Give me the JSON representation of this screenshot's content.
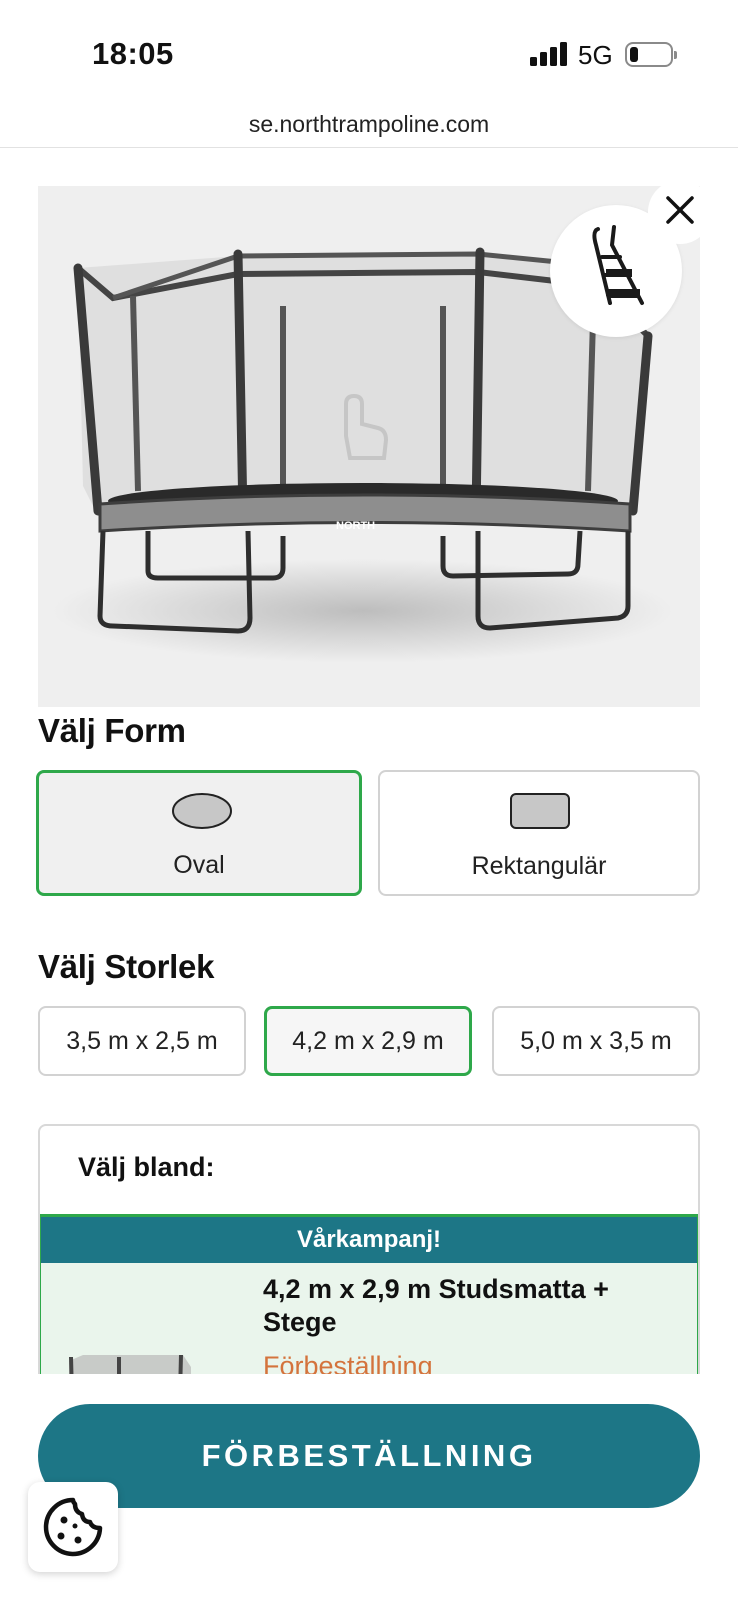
{
  "status_bar": {
    "time": "18:05",
    "network": "5G",
    "battery_level": 0.2
  },
  "browser": {
    "url": "se.northtrampoline.com"
  },
  "product_image": {
    "accessory_icon": "ladder-icon",
    "close_icon": "close-icon",
    "overlay_icon": "hand-pointer-icon"
  },
  "shape_section": {
    "title": "Välj Form",
    "options": [
      {
        "label": "Oval",
        "icon": "oval-shape-icon",
        "selected": true
      },
      {
        "label": "Rektangulär",
        "icon": "rectangle-shape-icon",
        "selected": false
      }
    ]
  },
  "size_section": {
    "title": "Välj Storlek",
    "options": [
      {
        "label": "3,5 m x 2,5 m",
        "selected": false
      },
      {
        "label": "4,2 m x 2,9 m",
        "selected": true
      },
      {
        "label": "5,0 m x 3,5 m",
        "selected": false
      }
    ]
  },
  "choose_section": {
    "title": "Välj bland:",
    "campaign": {
      "banner": "Vårkampanj!",
      "product_title": "4,2 m x 2,9 m Studsmatta + Stege",
      "status": "Förbeställning"
    }
  },
  "cta": {
    "label": "FÖRBESTÄLLNING"
  },
  "cookie": {
    "icon": "cookie-icon"
  },
  "colors": {
    "accent_green": "#2ea84a",
    "brand_teal": "#1d7686",
    "preorder_orange": "#d4733c"
  }
}
